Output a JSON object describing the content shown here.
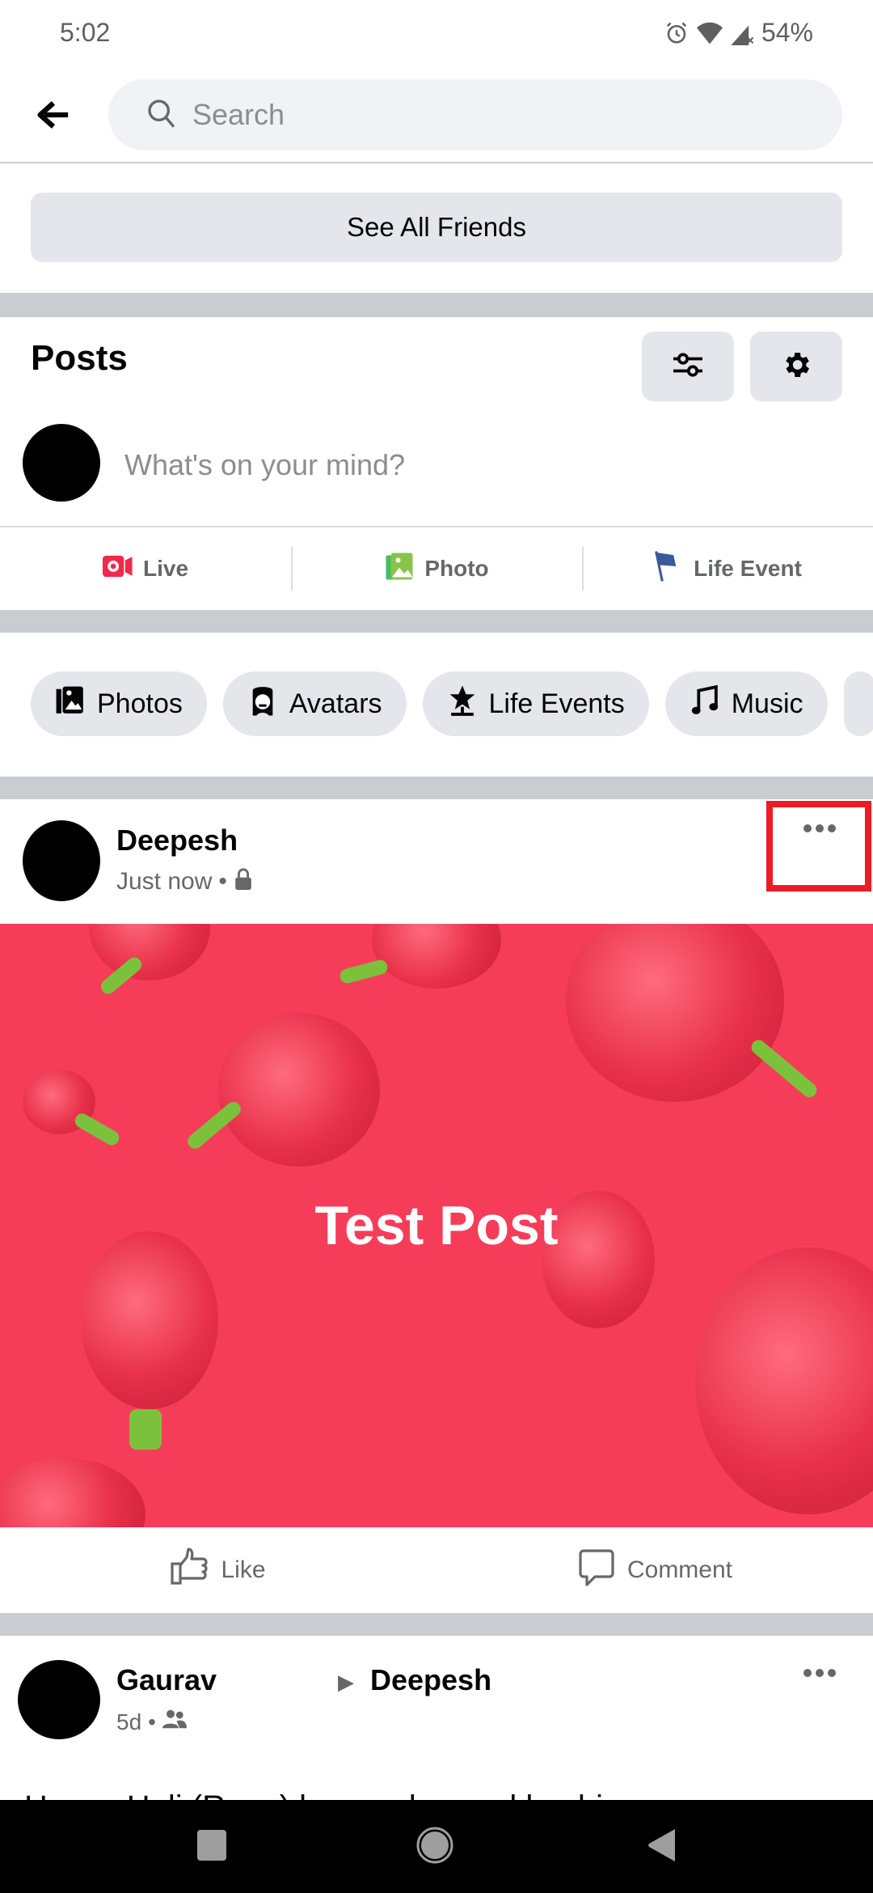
{
  "status_bar": {
    "time": "5:02",
    "battery": "54%",
    "icons": [
      "alarm-icon",
      "wifi-icon",
      "signal-no-data-icon"
    ]
  },
  "header": {
    "back_icon": "arrow-left-icon",
    "search_placeholder": "Search"
  },
  "friends": {
    "see_all_label": "See All Friends"
  },
  "posts_section": {
    "title": "Posts",
    "filter_icon": "sliders-icon",
    "settings_icon": "gear-icon",
    "composer_placeholder": "What's on your mind?",
    "actions": [
      {
        "label": "Live",
        "icon": "live-video-icon",
        "color": "#f02849"
      },
      {
        "label": "Photo",
        "icon": "photo-icon",
        "color": "#45bd62"
      },
      {
        "label": "Life Event",
        "icon": "flag-icon",
        "color": "#3b5998"
      }
    ]
  },
  "chips": [
    {
      "label": "Photos",
      "icon": "photos-icon"
    },
    {
      "label": "Avatars",
      "icon": "avatar-icon"
    },
    {
      "label": "Life Events",
      "icon": "life-event-star-icon"
    },
    {
      "label": "Music",
      "icon": "music-note-icon"
    }
  ],
  "post1": {
    "author": "Deepesh",
    "time": "Just now",
    "privacy_icon": "lock-icon",
    "image_text": "Test Post",
    "image_bg": "#f53d5a",
    "highlight_color": "#ed1c24",
    "like_label": "Like",
    "comment_label": "Comment"
  },
  "post2": {
    "author": "Gaurav",
    "target": "Deepesh",
    "time": "5d",
    "privacy_icon": "friends-icon",
    "body_partial": "Happy Holi (Rang) bane rahe aur khushi..."
  },
  "nav": {
    "recents_icon": "square-icon",
    "home_icon": "circle-icon",
    "back_icon": "triangle-back-icon"
  }
}
